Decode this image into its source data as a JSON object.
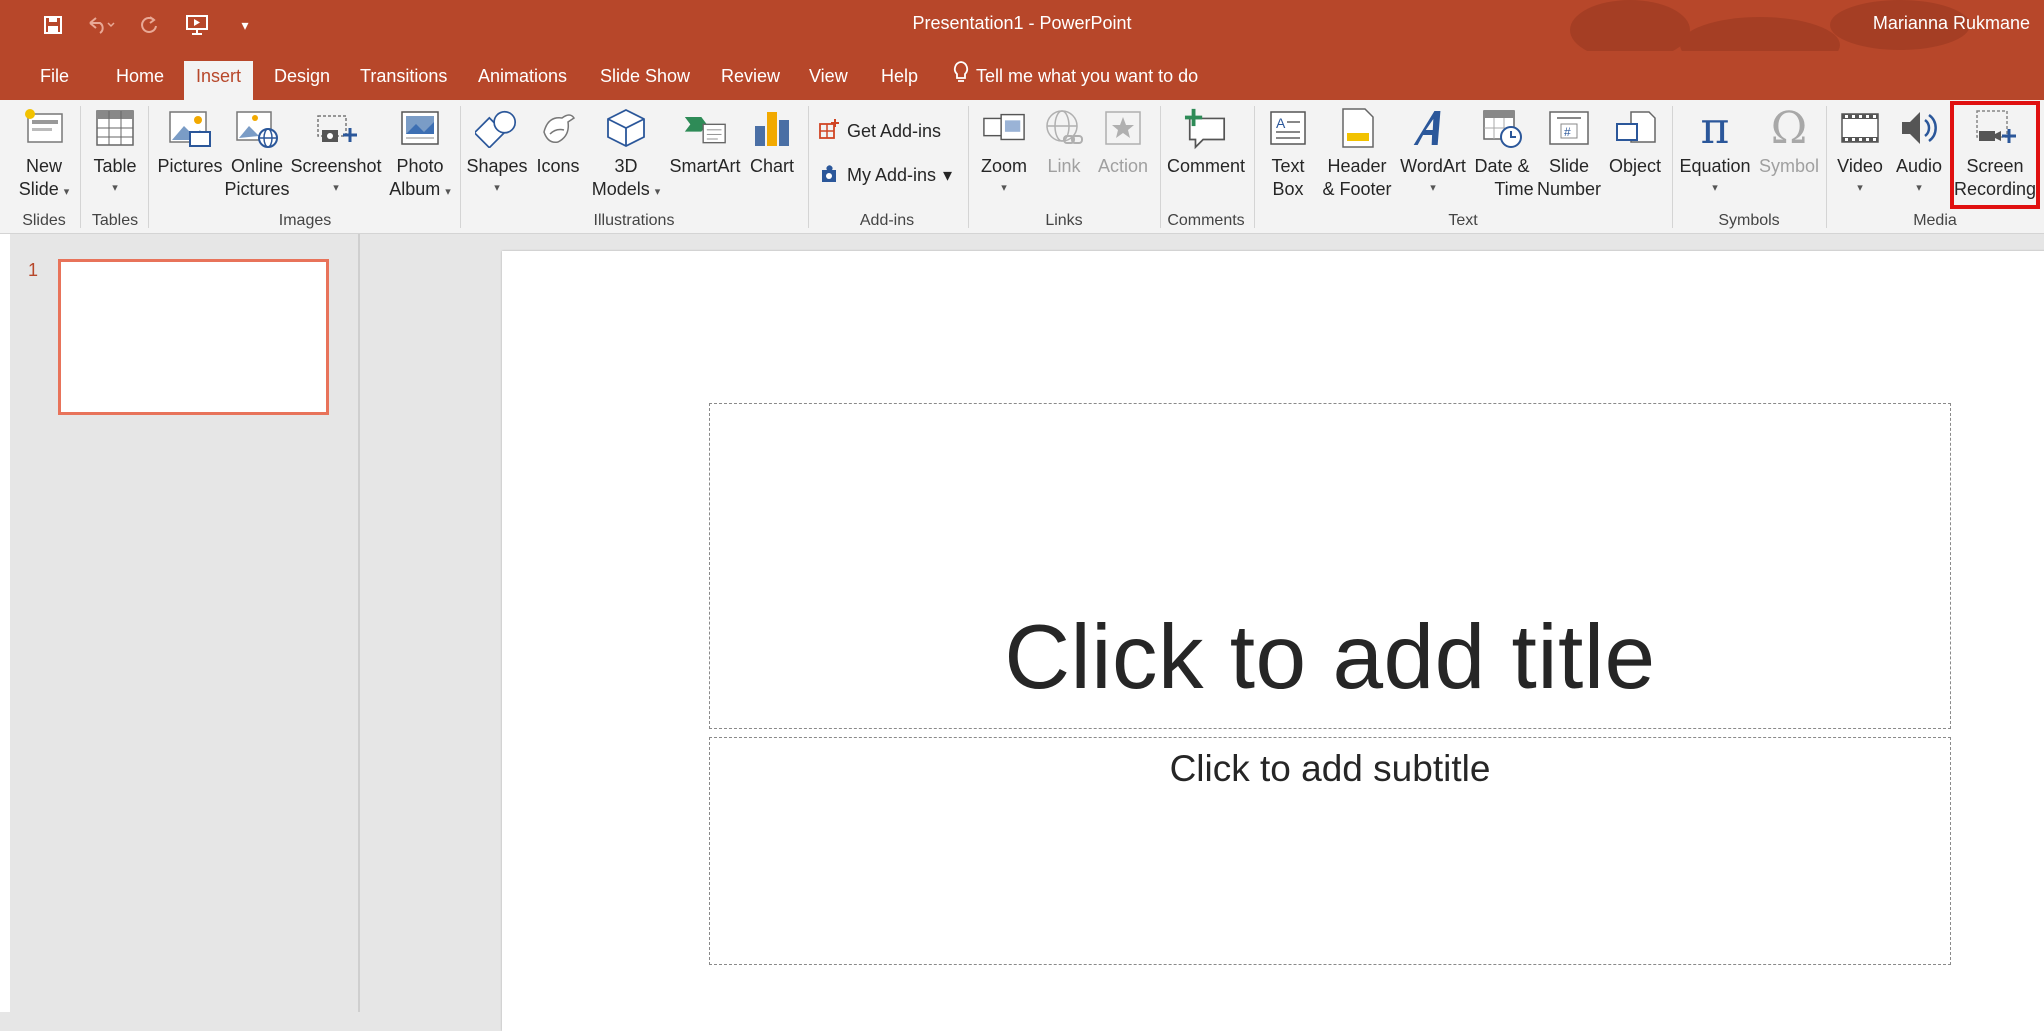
{
  "window": {
    "title": "Presentation1  -  PowerPoint",
    "user": "Marianna Rukmane",
    "accent_color": "#b7472a"
  },
  "quick_access": [
    "save-icon",
    "undo-icon",
    "redo-icon",
    "present-from-start-icon",
    "customize-qat-icon"
  ],
  "tabs": [
    "File",
    "Home",
    "Insert",
    "Design",
    "Transitions",
    "Animations",
    "Slide Show",
    "Review",
    "View",
    "Help"
  ],
  "active_tab": "Insert",
  "tell_me": "Tell me what you want to do",
  "ribbon": {
    "new_slide": [
      "New",
      "Slide"
    ],
    "table": "Table",
    "pictures": "Pictures",
    "online_pictures": [
      "Online",
      "Pictures"
    ],
    "screenshot": "Screenshot",
    "photo_album": [
      "Photo",
      "Album"
    ],
    "shapes": "Shapes",
    "icons": "Icons",
    "models_3d": [
      "3D",
      "Models"
    ],
    "smartart": "SmartArt",
    "chart": "Chart",
    "get_addins": "Get Add-ins",
    "my_addins": "My Add-ins",
    "zoom": "Zoom",
    "link": "Link",
    "action": "Action",
    "comment": "Comment",
    "text_box": [
      "Text",
      "Box"
    ],
    "header_footer": [
      "Header",
      "& Footer"
    ],
    "wordart": "WordArt",
    "date_time": [
      "Date &",
      "Time"
    ],
    "slide_number": [
      "Slide",
      "Number"
    ],
    "object": "Object",
    "equation": "Equation",
    "symbol": "Symbol",
    "video": "Video",
    "audio": "Audio",
    "screen_recording": [
      "Screen",
      "Recording"
    ],
    "groups": {
      "slides": "Slides",
      "tables": "Tables",
      "images": "Images",
      "illustrations": "Illustrations",
      "addins": "Add-ins",
      "links": "Links",
      "comments": "Comments",
      "text": "Text",
      "symbols": "Symbols",
      "media": "Media"
    }
  },
  "thumbnails": [
    {
      "number": "1"
    }
  ],
  "slide": {
    "title_placeholder": "Click to add title",
    "subtitle_placeholder": "Click to add subtitle"
  }
}
